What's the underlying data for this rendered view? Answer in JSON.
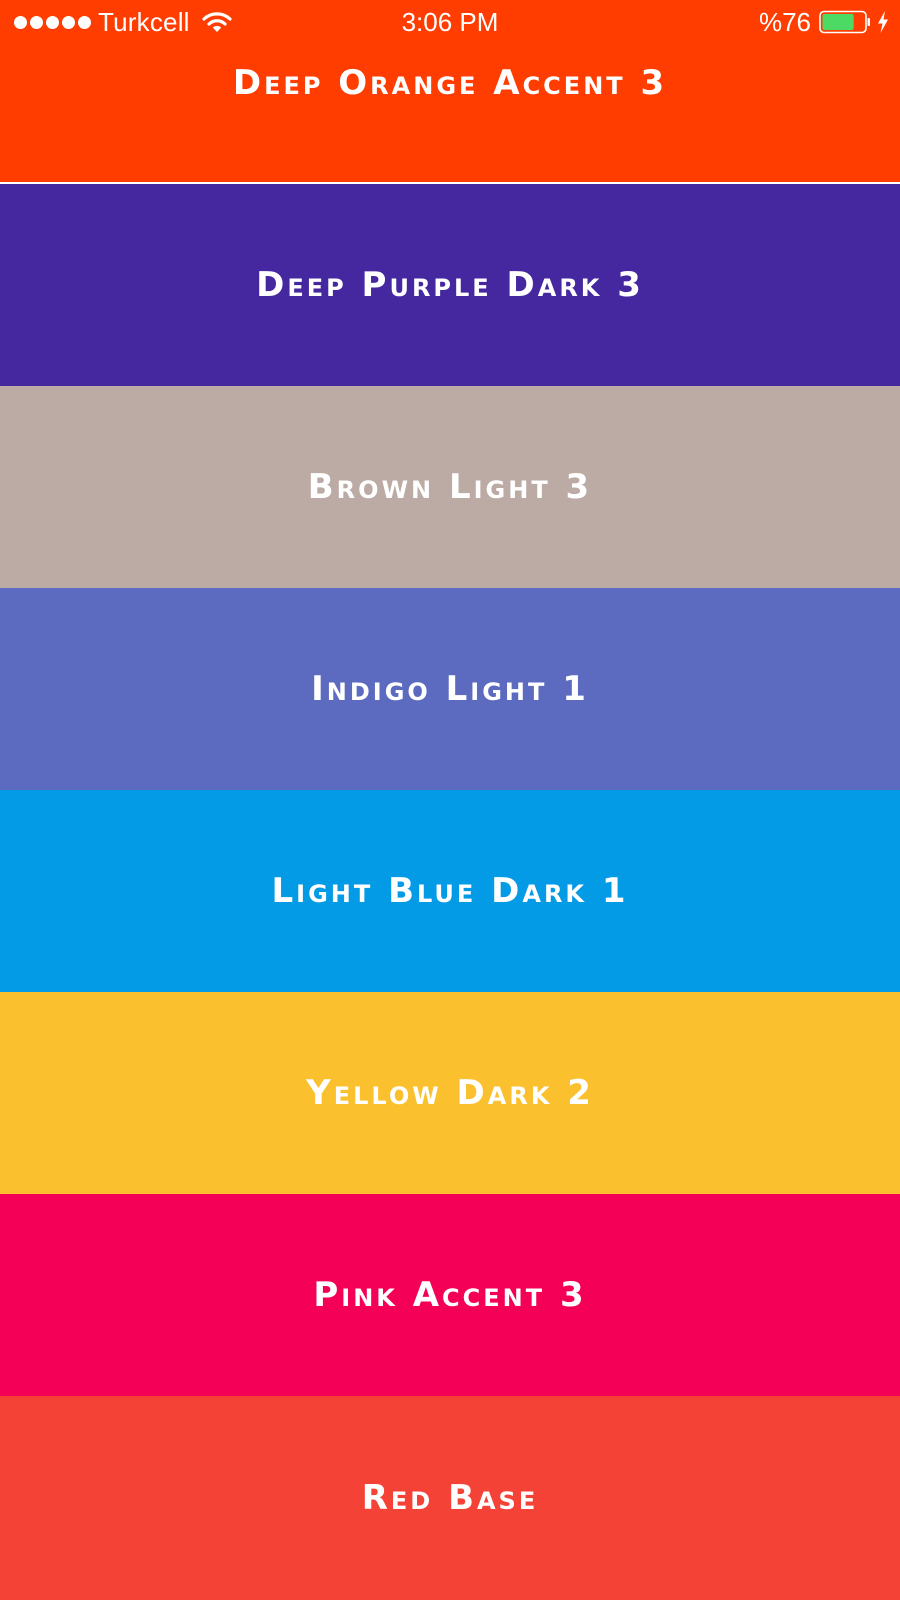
{
  "status_bar": {
    "carrier": "Turkcell",
    "time": "3:06 PM",
    "battery": "%76",
    "battery_level": 0.76,
    "signal_bars": 5
  },
  "colors": [
    {
      "label": "Deep Orange Accent 3",
      "hex": "#FF3D00"
    },
    {
      "label": "Deep Purple Dark 3",
      "hex": "#4527A0"
    },
    {
      "label": "Brown Light 3",
      "hex": "#BCAAA4"
    },
    {
      "label": "Indigo Light 1",
      "hex": "#5C6BC0"
    },
    {
      "label": "Light Blue Dark 1",
      "hex": "#039BE5"
    },
    {
      "label": "Yellow Dark 2",
      "hex": "#FBC02D"
    },
    {
      "label": "Pink Accent 3",
      "hex": "#F50057"
    },
    {
      "label": "Red Base",
      "hex": "#F44336"
    }
  ],
  "icons": {
    "signal": "signal-dots-icon",
    "wifi": "wifi-icon",
    "battery": "battery-icon",
    "charging": "charging-bolt-icon"
  }
}
